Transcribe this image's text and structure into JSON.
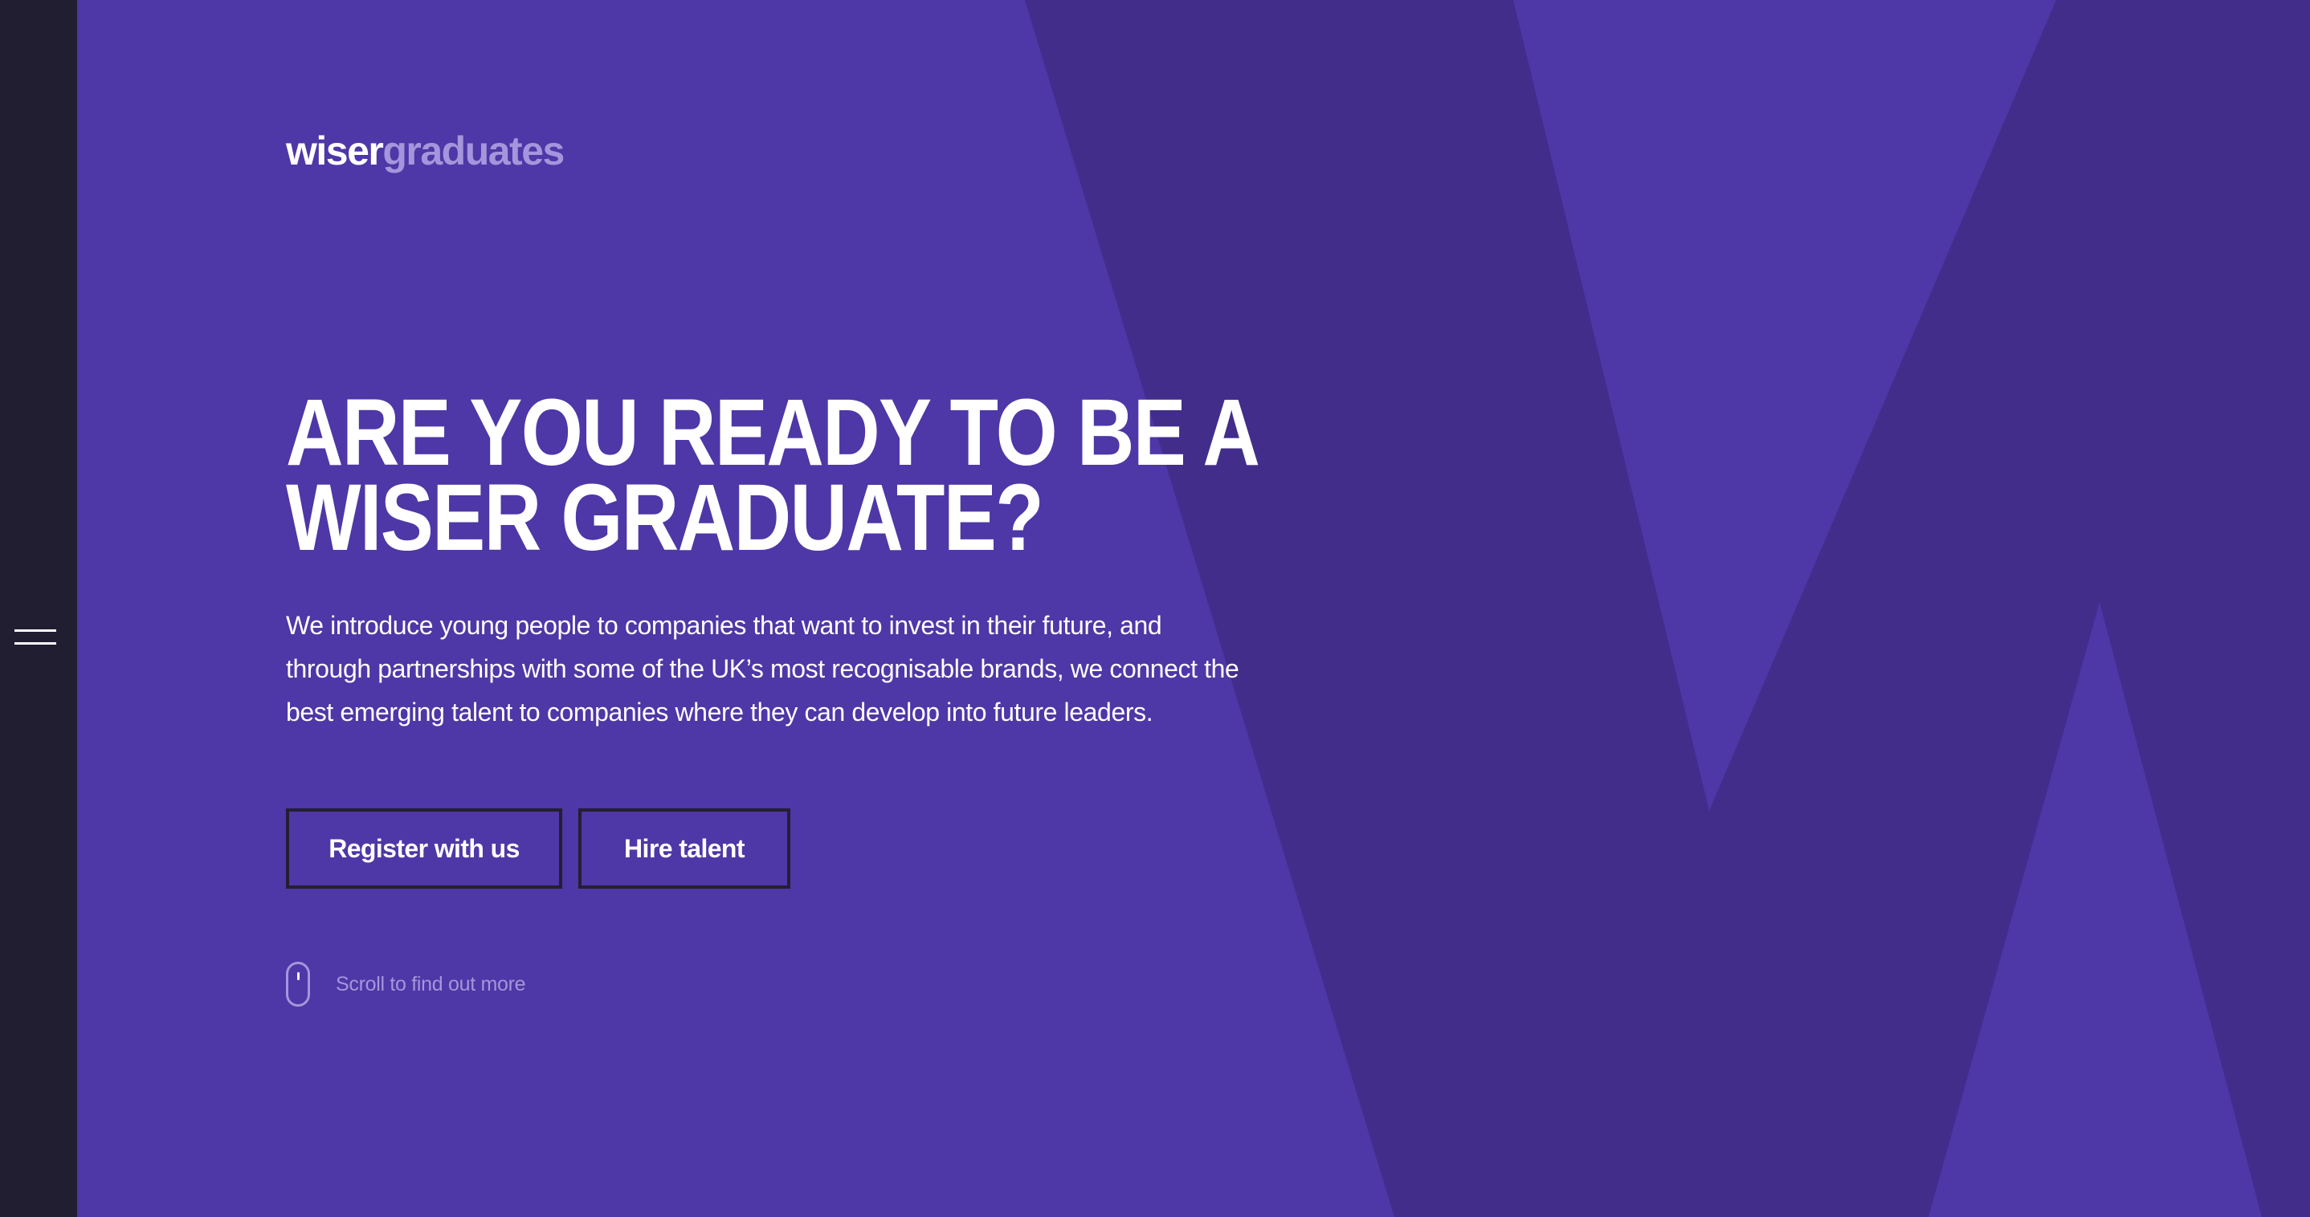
{
  "sidebar": {
    "menu_icon": "hamburger-menu-icon"
  },
  "logo": {
    "part1": "wiser",
    "part2": "graduates"
  },
  "hero": {
    "headline_line1": "ARE YOU READY TO BE A",
    "headline_line2": "WISER GRADUATE?",
    "intro": "We introduce young people to companies that want to invest in their future, and through partnerships with some of the UK’s most recognisable brands, we connect the best emerging talent to companies where they can develop into future leaders.",
    "register_label": "Register with us",
    "hire_label": "Hire talent",
    "scroll_label": "Scroll to find out more",
    "scroll_icon": "mouse-icon"
  },
  "colors": {
    "sidebar": "#221e32",
    "hero_bg": "#4e37a6",
    "hero_shape": "#422d8b",
    "logo_accent": "#a496dc",
    "button_border": "#231f33"
  }
}
